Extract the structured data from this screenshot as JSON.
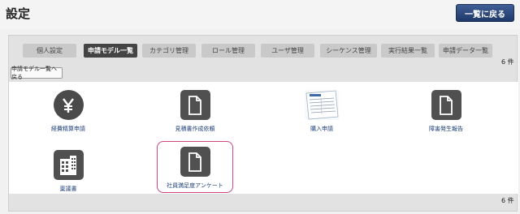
{
  "header": {
    "title": "設定",
    "back_button": "一覧に戻る"
  },
  "tabs": [
    {
      "label": "個人設定",
      "active": false
    },
    {
      "label": "申請モデル一覧",
      "active": true
    },
    {
      "label": "カテゴリ管理",
      "active": false
    },
    {
      "label": "ロール管理",
      "active": false
    },
    {
      "label": "ユーザ管理",
      "active": false
    },
    {
      "label": "シーケンス管理",
      "active": false
    },
    {
      "label": "実行結果一覧",
      "active": false
    },
    {
      "label": "申請データ一覧",
      "active": false
    }
  ],
  "count_top": "6 件",
  "count_bottom": "6 件",
  "list_back_button": "申請モデル一覧へ戻る",
  "items": [
    {
      "label": "経費精算申請",
      "icon": "yen-icon"
    },
    {
      "label": "見積書作成依頼",
      "icon": "document-icon"
    },
    {
      "label": "購入申請",
      "icon": "form-photo-icon"
    },
    {
      "label": "障害発生報告",
      "icon": "document-icon"
    },
    {
      "label": "稟議書",
      "icon": "building-icon"
    },
    {
      "label": "社員満足度アンケート",
      "icon": "document-icon",
      "highlighted": true
    }
  ],
  "colors": {
    "accent": "#2a4a80",
    "highlight": "#d2457e",
    "icon_bg": "#505050",
    "link": "#1d3f7a"
  }
}
